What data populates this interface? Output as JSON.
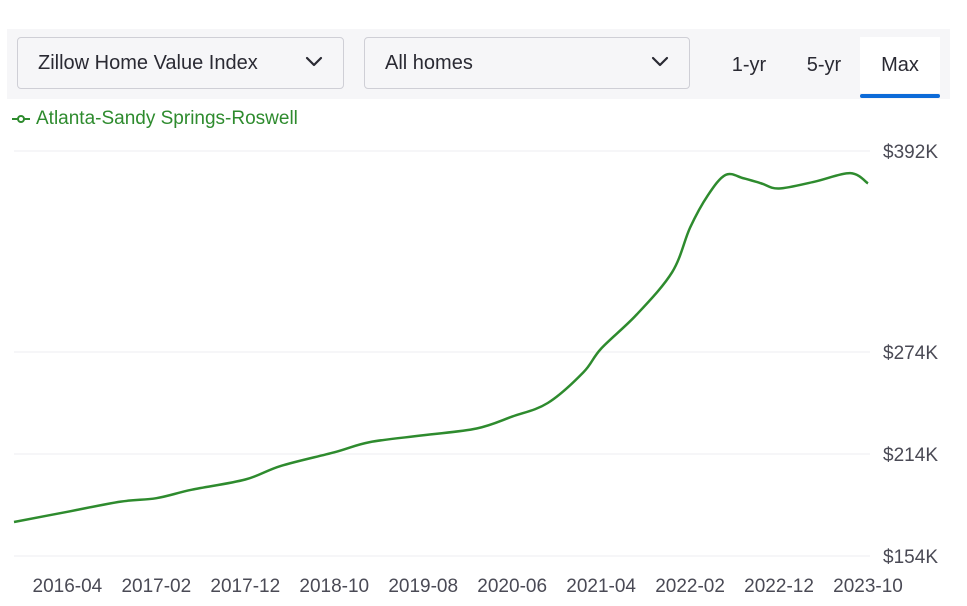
{
  "controls": {
    "metric_select": "Zillow Home Value Index",
    "home_type_select": "All homes",
    "ranges": [
      {
        "label": "1-yr",
        "active": false
      },
      {
        "label": "5-yr",
        "active": false
      },
      {
        "label": "Max",
        "active": true
      }
    ],
    "accent_color": "#0d6bd8"
  },
  "legend": {
    "label": "Atlanta-Sandy Springs-Roswell",
    "color": "#2e8b2e"
  },
  "chart_data": {
    "type": "line",
    "title": "",
    "xlabel": "",
    "ylabel": "",
    "x_tick_labels": [
      "2016-04",
      "2017-02",
      "2017-12",
      "2018-10",
      "2019-08",
      "2020-06",
      "2021-04",
      "2022-02",
      "2022-12",
      "2023-10"
    ],
    "y_tick_labels": [
      "$392K",
      "$274K",
      "$214K",
      "$154K"
    ],
    "y_ticks": [
      392,
      274,
      214,
      154
    ],
    "ylim": [
      154,
      392
    ],
    "grid": true,
    "legend_position": "top-left",
    "series": [
      {
        "name": "Atlanta-Sandy Springs-Roswell",
        "color": "#2e8b2e",
        "x": [
          "2015-10",
          "2016-04",
          "2016-10",
          "2017-02",
          "2017-06",
          "2017-12",
          "2018-04",
          "2018-10",
          "2019-02",
          "2019-08",
          "2020-02",
          "2020-06",
          "2020-10",
          "2021-02",
          "2021-04",
          "2021-08",
          "2021-12",
          "2022-02",
          "2022-04",
          "2022-06",
          "2022-08",
          "2022-10",
          "2022-12",
          "2023-04",
          "2023-08",
          "2023-10"
        ],
        "values": [
          174,
          180,
          186,
          188,
          193,
          199,
          207,
          215,
          221,
          225,
          229,
          236,
          244,
          262,
          276,
          296,
          321,
          347,
          366,
          378,
          376,
          373,
          370,
          374,
          379,
          373
        ]
      }
    ]
  }
}
